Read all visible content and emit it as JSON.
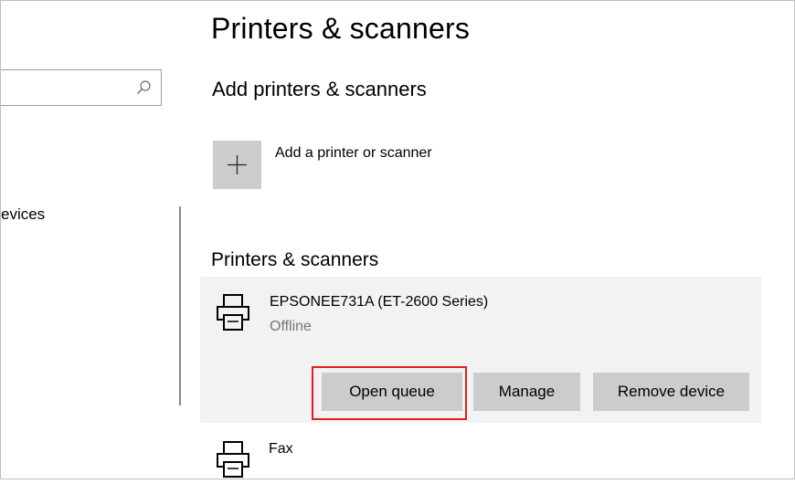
{
  "sidebar": {
    "search": {
      "placeholder": "",
      "icon": "search-icon"
    },
    "nav_item_partial": "evices"
  },
  "main": {
    "page_title": "Printers & scanners",
    "add_section_title": "Add printers & scanners",
    "add_button_label": "Add a printer or scanner",
    "list_title": "Printers & scanners",
    "devices": [
      {
        "name": "EPSONEE731A (ET-2600 Series)",
        "status": "Offline",
        "icon": "printer-icon",
        "actions": {
          "open_queue": "Open queue",
          "manage": "Manage",
          "remove": "Remove device"
        }
      },
      {
        "name": "Fax",
        "icon": "printer-icon"
      }
    ]
  },
  "colors": {
    "button_bg": "#cccccc",
    "card_bg": "#f2f2f2",
    "status_text": "#767676",
    "highlight": "#e0201c"
  }
}
